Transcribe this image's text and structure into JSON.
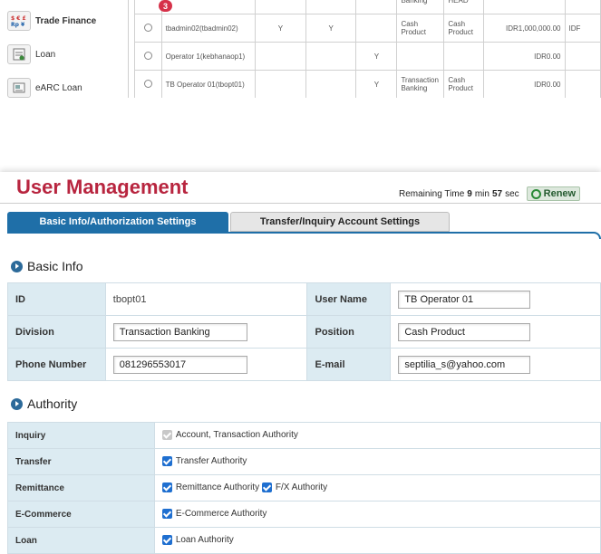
{
  "sidebar": {
    "items": [
      {
        "label": "Trade Finance",
        "icon": "trade-finance-icon"
      },
      {
        "label": "Loan",
        "icon": "loan-icon"
      },
      {
        "label": "eARC Loan",
        "icon": "earc-loan-icon"
      }
    ]
  },
  "top_table": {
    "partial_row": [
      "Banking",
      "HEAD"
    ],
    "rows": [
      {
        "user": "tbadmin02(tbadmin02)",
        "c1": "Y",
        "c2": "Y",
        "c3": "",
        "division": "Cash Product",
        "position": "Cash Product",
        "amount": "IDR1,000,000.00",
        "extra": "IDF"
      },
      {
        "user": "Operator 1(kebhanaop1)",
        "c1": "",
        "c2": "",
        "c3": "Y",
        "division": "",
        "position": "",
        "amount": "IDR0.00",
        "extra": ""
      },
      {
        "user": "TB Operator 01(tbopt01)",
        "c1": "",
        "c2": "",
        "c3": "Y",
        "division": "Transaction Banking",
        "position": "Cash Product",
        "amount": "IDR0.00",
        "extra": ""
      }
    ],
    "step_badge": "3"
  },
  "header": {
    "title": "User Management",
    "remaining_label": "Remaining Time",
    "minutes": "9",
    "min_label": "min",
    "seconds": "57",
    "sec_label": "sec",
    "renew_label": "Renew"
  },
  "tabs": [
    {
      "label": "Basic Info/Authorization Settings",
      "active": true
    },
    {
      "label": "Transfer/Inquiry Account Settings",
      "active": false
    }
  ],
  "basic_info": {
    "heading": "Basic Info",
    "id_label": "ID",
    "id_value": "tbopt01",
    "user_name_label": "User Name",
    "user_name_value": "TB Operator 01",
    "division_label": "Division",
    "division_value": "Transaction Banking",
    "position_label": "Position",
    "position_value": "Cash Product",
    "phone_label": "Phone Number",
    "phone_value": "081296553017",
    "email_label": "E-mail",
    "email_value": "septilia_s@yahoo.com"
  },
  "authority": {
    "heading": "Authority",
    "rows": [
      {
        "label": "Inquiry",
        "options": [
          "Account, Transaction Authority"
        ]
      },
      {
        "label": "Transfer",
        "options": [
          "Transfer Authority"
        ]
      },
      {
        "label": "Remittance",
        "options": [
          "Remittance Authority",
          "F/X Authority"
        ]
      },
      {
        "label": "E-Commerce",
        "options": [
          "E-Commerce Authority"
        ]
      },
      {
        "label": "Loan",
        "options": [
          "Loan Authority"
        ]
      }
    ]
  },
  "colors": {
    "title": "#b8253f",
    "tab_active": "#1f6fa8",
    "label_bg": "#dcebf2",
    "checkbox": "#1f6fd0",
    "badge": "#d6324a"
  }
}
